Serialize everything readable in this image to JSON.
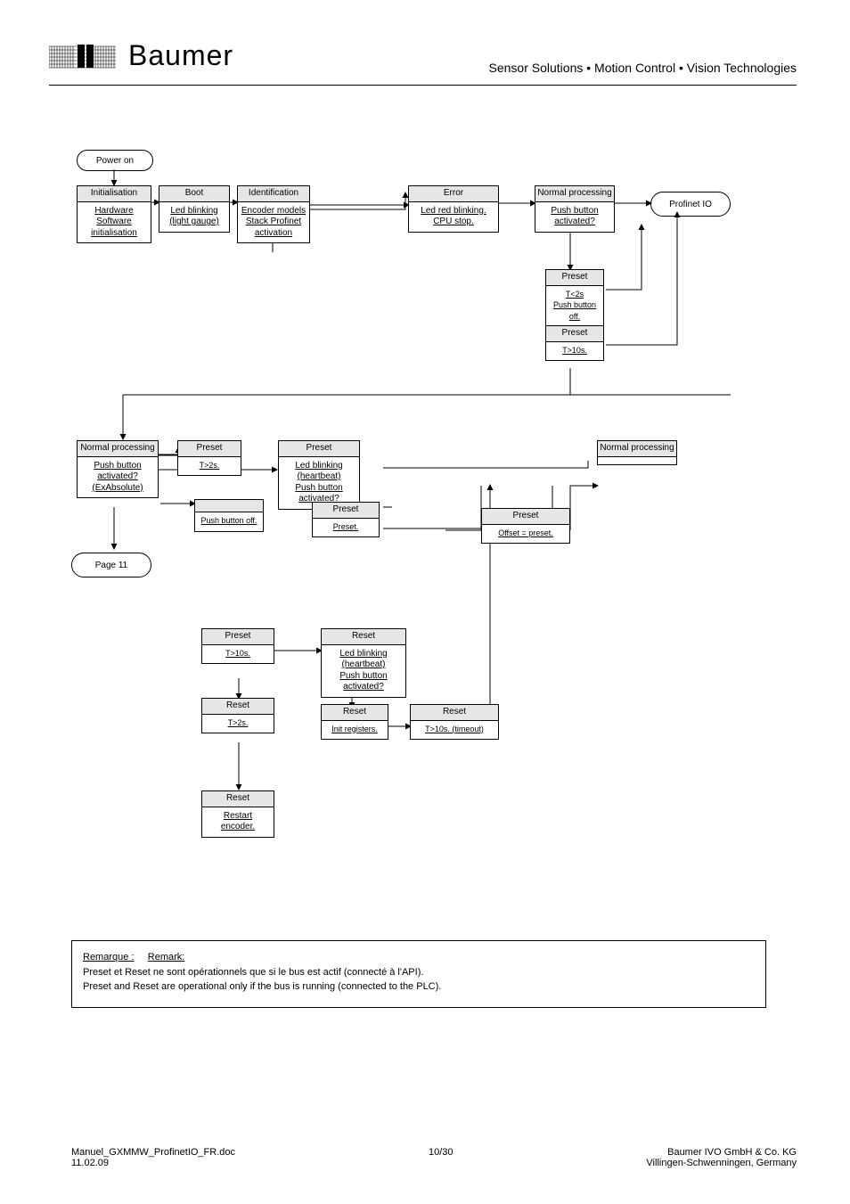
{
  "header": {
    "brand": "Baumer",
    "tagline": "Sensor Solutions • Motion Control • Vision Technologies"
  },
  "terminators": {
    "power_on": "Power on",
    "profinet_io": "Profinet IO",
    "page_11": "Page 11"
  },
  "nodes": {
    "initialisation": {
      "head": "Initialisation",
      "body": "Hardware\nSoftware\ninitialisation"
    },
    "boot": {
      "head": "Boot",
      "body": "Led blinking\n(light gauge)"
    },
    "identification": {
      "head": "Identification",
      "body": "Encoder models\nStack Profinet\nactivation"
    },
    "error": {
      "head": "Error",
      "body": "Led red blinking.\nCPU stop."
    },
    "normal1": {
      "head": "Normal processing",
      "body": "Push button\nactivated?"
    },
    "t_off": {
      "head": "Preset",
      "body": "T<2s\nPush button off."
    },
    "t_2s": {
      "head": "Preset",
      "body": "T>2s."
    },
    "t_10s": {
      "head": "Preset",
      "body": "T>10s."
    },
    "normal2": {
      "head": "Normal processing",
      "body": "Push button\nactivated?\n(ExAbsolute)"
    },
    "n2_off": {
      "head": "",
      "body": "Push button off."
    },
    "preset_preset": {
      "head": "Preset",
      "body": "Preset."
    },
    "preset_blink1": {
      "head": "Preset",
      "body": "Led blinking\n(heartbeat)\nPush button\nactivated?"
    },
    "preset_offset": {
      "head": "Preset",
      "body": "Offset = preset."
    },
    "preset_timeout": {
      "head": "Preset",
      "body": "T>10s. (timeout)"
    },
    "normal3": {
      "head": "Normal processing",
      "body": ""
    },
    "reset_t": {
      "head": "Reset",
      "body": "T>2s."
    },
    "reset_init": {
      "head": "Reset",
      "body": "Init registers."
    },
    "reset_blink": {
      "head": "Reset",
      "body": "Led blinking\n(heartbeat)\nPush button\nactivated?"
    },
    "reset_off": {
      "head": "Reset",
      "body": "Push button off."
    },
    "reset_timeout": {
      "head": "Reset",
      "body": "T>10s. (timeout)"
    },
    "reset_restart": {
      "head": "Reset",
      "body": "Restart\nencoder."
    }
  },
  "note": {
    "label_fr": "Remarque :",
    "label_en": "Remark:",
    "text": "Preset et Reset ne sont opérationnels que si le bus est actif (connecté à l'API).\nPreset and Reset are operational only if the bus is running (connected to the PLC)."
  },
  "footer": {
    "left": "Manuel_GXMMW_ProfinetIO_FR.doc",
    "center": "10/30",
    "right_org": "Baumer IVO GmbH & Co. KG",
    "right_loc": "Villingen-Schwenningen, Germany",
    "date": "11.02.09"
  }
}
